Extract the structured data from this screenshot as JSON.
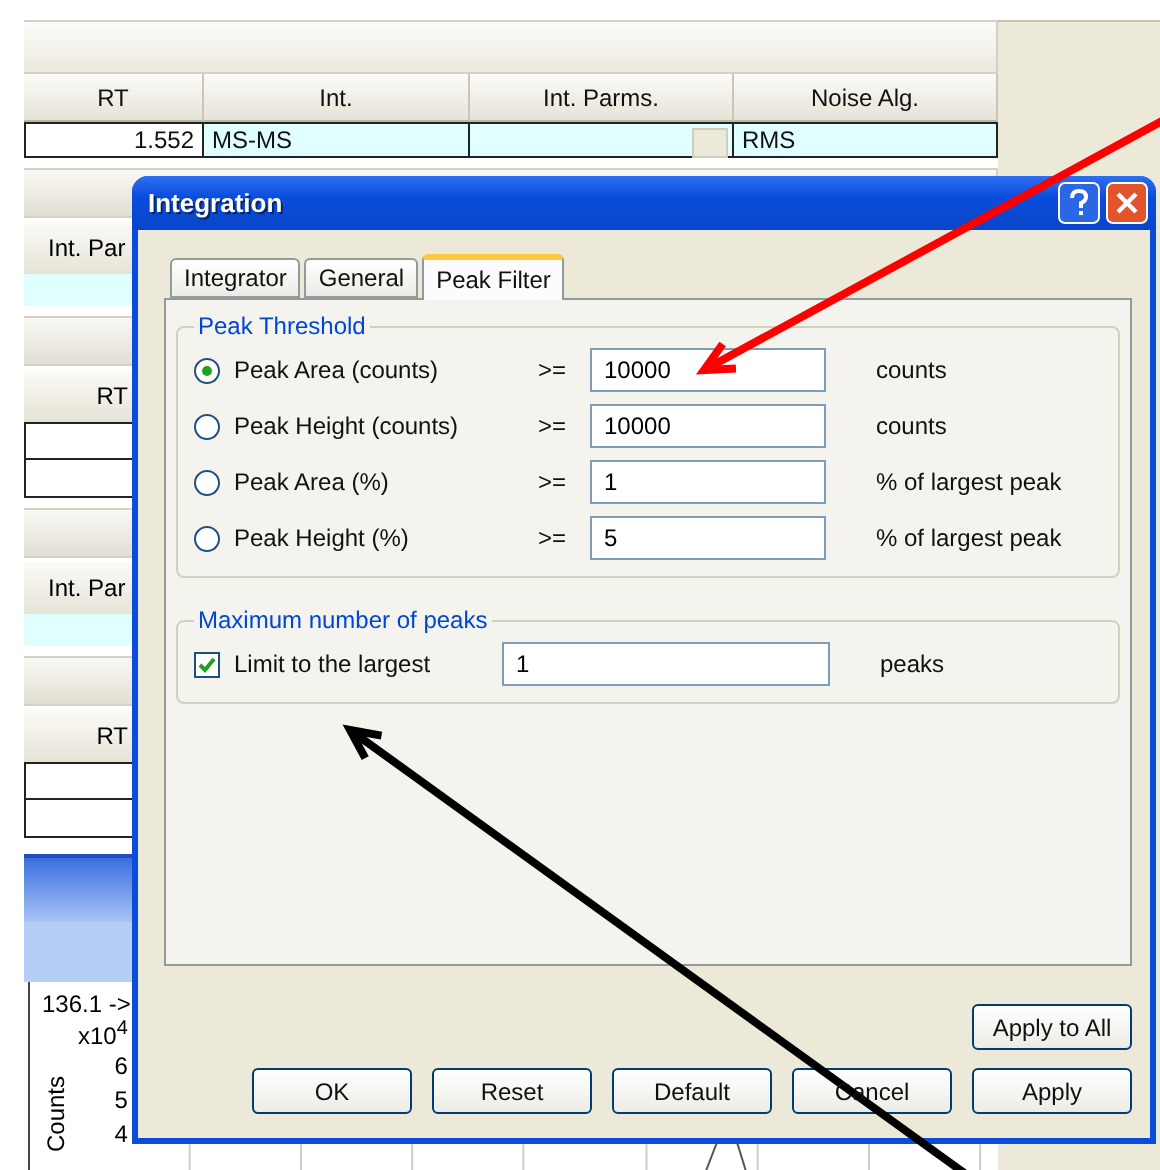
{
  "background": {
    "table": {
      "columns": [
        "RT",
        "Int.",
        "Int. Parms.",
        "Noise Alg."
      ],
      "row": [
        {
          "kind": "number",
          "text": "1.552"
        },
        {
          "kind": "text",
          "text": "MS-MS"
        },
        {
          "kind": "button"
        },
        {
          "kind": "text",
          "text": "RMS"
        }
      ]
    },
    "panels": [
      {
        "header": "Int. Par",
        "kind": "cyan"
      },
      {
        "header": "RT",
        "kind": "white"
      },
      {
        "header": "Int. Par",
        "kind": "cyan"
      },
      {
        "header": "RT",
        "kind": "white"
      }
    ],
    "plot": {
      "title": "136.1 ->",
      "ylabel": "Counts",
      "scale": "x10$^{4}$",
      "ticks": [
        "6",
        "5",
        "4"
      ]
    }
  },
  "dialog": {
    "title": "Integration",
    "tabs": [
      {
        "label": "Integrator",
        "selected": false
      },
      {
        "label": "General",
        "selected": false
      },
      {
        "label": "Peak Filter",
        "selected": true
      }
    ],
    "threshold": {
      "title": "Peak Threshold",
      "rows": [
        {
          "label": "Peak Area (counts)",
          "selected": true,
          "op": ">=",
          "value": "10000",
          "unit": "counts"
        },
        {
          "label": "Peak Height (counts)",
          "selected": false,
          "op": ">=",
          "value": "10000",
          "unit": "counts"
        },
        {
          "label": "Peak Area (%)",
          "selected": false,
          "op": ">=",
          "value": "1",
          "unit": "% of largest peak"
        },
        {
          "label": "Peak Height (%)",
          "selected": false,
          "op": ">=",
          "value": "5",
          "unit": "% of largest peak"
        }
      ]
    },
    "max_peaks": {
      "title": "Maximum number of peaks",
      "label": "Limit to the largest",
      "checked": true,
      "value": "1",
      "unit": "peaks"
    },
    "apply_all": "Apply to All",
    "buttons": [
      "OK",
      "Reset",
      "Default",
      "Cancel",
      "Apply"
    ]
  },
  "annotations": [
    {
      "kind": "arrow",
      "color": "#ff0000"
    },
    {
      "kind": "arrow",
      "color": "#000000"
    }
  ]
}
